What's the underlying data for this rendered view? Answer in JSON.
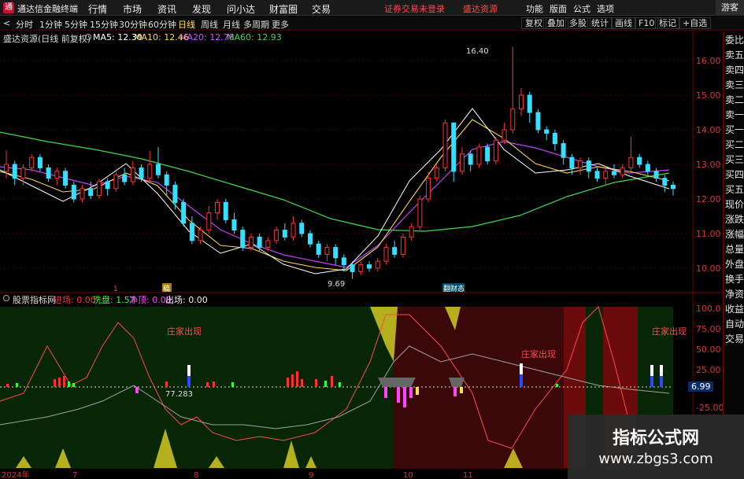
{
  "app": {
    "name": "通达信金融终端"
  },
  "menu": [
    "行情",
    "市场",
    "资讯",
    "发现",
    "问小达",
    "财富圈",
    "交易"
  ],
  "warning": "证券交易未登录",
  "source": "盛达资源",
  "right_menu": [
    "功能",
    "版面",
    "公式",
    "选项"
  ],
  "guest": "游客",
  "toolbar": {
    "periods": [
      "分时",
      "1分钟",
      "5分钟",
      "15分钟",
      "30分钟",
      "60分钟",
      "日线",
      "周线",
      "月线",
      "多周期",
      "更多"
    ],
    "selected": "日线",
    "right_buttons": [
      "复权",
      "叠加",
      "多股",
      "统计",
      "画线",
      "F10",
      "标记",
      "+自选"
    ],
    "nav": "<"
  },
  "stock": {
    "title": "盛达资源(日线 前复权)",
    "ma5": "MA5: 12.30",
    "ma10": "MA10: 12.46",
    "ma20": "MA20: 12.78",
    "ma60": "MA60: 12.93"
  },
  "price_axis": [
    "16.00",
    "15.00",
    "14.00",
    "13.00",
    "12.00",
    "11.00",
    "10.00"
  ],
  "price_annotations": {
    "high": "16.40",
    "low": "9.69"
  },
  "markers": {
    "m1": "1",
    "m2": "稿",
    "m3": "翻财态"
  },
  "indicator": {
    "title": "股票指标网",
    "labels": [
      {
        "text": "进场: 0.00",
        "color": "#ff3333"
      },
      {
        "text": "洗盘: 1.57",
        "color": "#33ff33"
      },
      {
        "text": "净顶: 0.00",
        "color": "#ff44ff"
      },
      {
        "text": "出场: 0.00",
        "color": "#eeeeee"
      }
    ],
    "value_label": "77.283",
    "annotations": [
      "庄家出现",
      "庄家出现",
      "庄家出现"
    ],
    "axis": [
      "100.0",
      "75.00",
      "50.00",
      "25.00",
      "-25.00"
    ],
    "current": "6.99"
  },
  "date_axis": [
    "2024年",
    "7",
    "8",
    "9",
    "10",
    "11"
  ],
  "sidebar": [
    "委比",
    "卖五",
    "卖四",
    "卖三",
    "卖二",
    "卖一",
    "买一",
    "买二",
    "买三",
    "买四",
    "买五",
    "现价",
    "涨跌",
    "涨幅",
    "总量",
    "外盘",
    "换手",
    "净资",
    "收益",
    "自动",
    "交易"
  ],
  "watermark": {
    "title": "指标公式网",
    "url": "www.zbgs3.com"
  },
  "colors": {
    "up": "#ff3030",
    "down": "#33e0ff",
    "ma5": "#ffffff",
    "ma10": "#ffd54a",
    "ma20": "#d050ff",
    "ma60": "#3fd84a"
  },
  "chart_data": {
    "type": "candlestick",
    "title": "盛达资源(日线 前复权)",
    "ylim": [
      9.5,
      16.5
    ],
    "candles": [
      [
        12.8,
        13.0,
        13.4,
        12.6
      ],
      [
        13.0,
        12.6,
        13.1,
        12.4
      ],
      [
        12.6,
        12.9,
        13.0,
        12.4
      ],
      [
        12.9,
        13.2,
        13.3,
        12.8
      ],
      [
        13.2,
        12.9,
        13.3,
        12.8
      ],
      [
        12.9,
        12.6,
        13.0,
        12.5
      ],
      [
        12.6,
        12.8,
        12.9,
        12.4
      ],
      [
        12.8,
        12.4,
        12.9,
        12.3
      ],
      [
        12.4,
        12.0,
        12.5,
        11.9
      ],
      [
        12.0,
        12.3,
        12.4,
        11.9
      ],
      [
        12.3,
        12.1,
        12.5,
        12.0
      ],
      [
        12.1,
        12.5,
        12.6,
        12.0
      ],
      [
        12.5,
        12.3,
        12.6,
        12.1
      ],
      [
        12.3,
        12.7,
        12.8,
        12.2
      ],
      [
        12.7,
        12.5,
        12.9,
        12.4
      ],
      [
        12.5,
        12.9,
        13.1,
        12.4
      ],
      [
        12.9,
        12.6,
        13.0,
        12.5
      ],
      [
        12.6,
        13.0,
        13.4,
        12.5
      ],
      [
        13.0,
        12.7,
        13.5,
        12.6
      ],
      [
        12.7,
        12.4,
        12.8,
        12.1
      ],
      [
        12.4,
        11.9,
        12.5,
        11.7
      ],
      [
        11.9,
        11.3,
        12.0,
        11.2
      ],
      [
        11.3,
        10.8,
        11.5,
        10.7
      ],
      [
        10.8,
        11.1,
        11.2,
        10.7
      ],
      [
        11.1,
        11.6,
        11.8,
        11.0
      ],
      [
        11.6,
        11.9,
        12.0,
        11.4
      ],
      [
        11.9,
        11.4,
        12.0,
        11.3
      ],
      [
        11.4,
        11.1,
        11.6,
        11.0
      ],
      [
        11.1,
        10.6,
        11.2,
        10.5
      ],
      [
        10.6,
        10.9,
        11.0,
        10.5
      ],
      [
        10.9,
        10.6,
        11.0,
        10.5
      ],
      [
        10.6,
        10.8,
        10.9,
        10.5
      ],
      [
        10.8,
        11.1,
        11.2,
        10.7
      ],
      [
        11.1,
        10.9,
        11.3,
        10.8
      ],
      [
        10.9,
        11.3,
        11.5,
        10.8
      ],
      [
        11.3,
        11.0,
        11.4,
        10.9
      ],
      [
        11.0,
        10.7,
        11.1,
        10.6
      ],
      [
        10.7,
        10.4,
        10.8,
        10.3
      ],
      [
        10.4,
        10.6,
        10.7,
        10.2
      ],
      [
        10.6,
        10.3,
        10.7,
        10.1
      ],
      [
        10.3,
        10.1,
        10.4,
        9.9
      ],
      [
        10.1,
        9.9,
        10.2,
        9.69
      ],
      [
        9.9,
        10.1,
        10.2,
        9.8
      ],
      [
        10.1,
        10.0,
        10.2,
        9.9
      ],
      [
        10.0,
        10.2,
        10.3,
        9.9
      ],
      [
        10.2,
        10.6,
        10.7,
        10.1
      ],
      [
        10.6,
        10.4,
        10.8,
        10.3
      ],
      [
        10.4,
        10.9,
        11.0,
        10.3
      ],
      [
        10.9,
        11.2,
        11.3,
        10.8
      ],
      [
        11.2,
        12.0,
        12.1,
        11.1
      ],
      [
        12.0,
        12.6,
        12.8,
        11.9
      ],
      [
        12.6,
        12.9,
        13.0,
        12.5
      ],
      [
        12.9,
        14.2,
        14.3,
        12.8
      ],
      [
        14.2,
        12.8,
        14.0,
        12.5
      ],
      [
        12.8,
        13.3,
        13.5,
        12.7
      ],
      [
        13.3,
        13.0,
        13.4,
        12.8
      ],
      [
        13.0,
        13.5,
        13.6,
        12.9
      ],
      [
        13.5,
        13.1,
        13.6,
        13.0
      ],
      [
        13.1,
        13.7,
        13.8,
        13.0
      ],
      [
        13.7,
        14.0,
        14.2,
        13.6
      ],
      [
        14.0,
        14.6,
        16.4,
        13.9
      ],
      [
        14.6,
        15.0,
        15.2,
        14.4
      ],
      [
        15.0,
        14.5,
        15.1,
        14.2
      ],
      [
        14.5,
        14.0,
        14.6,
        13.9
      ],
      [
        14.0,
        13.9,
        14.1,
        13.7
      ],
      [
        13.9,
        13.6,
        14.0,
        13.4
      ],
      [
        13.6,
        13.2,
        13.7,
        13.0
      ],
      [
        13.2,
        12.9,
        13.3,
        12.7
      ],
      [
        12.9,
        13.1,
        13.2,
        12.7
      ],
      [
        13.1,
        12.8,
        13.2,
        12.6
      ],
      [
        12.8,
        12.6,
        12.9,
        12.5
      ],
      [
        12.6,
        12.8,
        12.9,
        12.4
      ],
      [
        12.8,
        12.7,
        13.0,
        12.6
      ],
      [
        12.7,
        12.9,
        13.0,
        12.6
      ],
      [
        12.9,
        13.2,
        13.8,
        12.8
      ],
      [
        13.2,
        13.0,
        13.3,
        12.9
      ],
      [
        13.0,
        12.8,
        13.1,
        12.7
      ],
      [
        12.8,
        12.6,
        12.9,
        12.5
      ],
      [
        12.6,
        12.4,
        12.7,
        12.2
      ],
      [
        12.4,
        12.3,
        12.5,
        12.1
      ]
    ]
  }
}
